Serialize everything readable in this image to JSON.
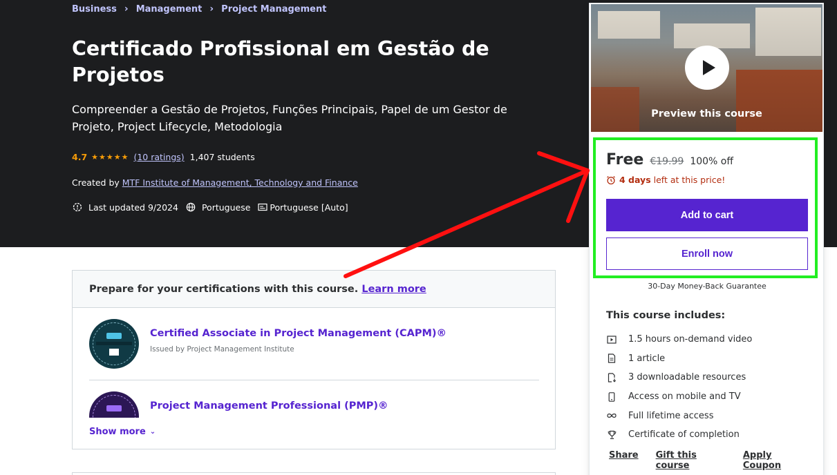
{
  "breadcrumb": {
    "items": [
      "Business",
      "Management",
      "Project Management"
    ],
    "separator": "›"
  },
  "course": {
    "title": "Certificado Profissional em Gestão de Projetos",
    "subtitle": "Compreender a Gestão de Projetos, Funções Principais, Papel de um Gestor de Projeto, Project Lifecycle, Metodologia",
    "rating": "4.7",
    "ratings_count": "(10 ratings)",
    "students": "1,407 students",
    "created_by_label": "Created by",
    "author": "MTF Institute of Management, Technology and Finance",
    "last_updated": "Last updated 9/2024",
    "language": "Portuguese",
    "captions": "Portuguese [Auto]"
  },
  "certifications": {
    "heading": "Prepare for your certifications with this course.",
    "learn_more": "Learn more",
    "items": [
      {
        "title": "Certified Associate in Project Management (CAPM)®",
        "issuer": "Issued by Project Management Institute"
      },
      {
        "title": "Project Management Professional (PMP)®",
        "issuer": ""
      }
    ],
    "show_more": "Show more"
  },
  "sidebar": {
    "preview_label": "Preview this course",
    "price": "Free",
    "original_price": "€19.99",
    "discount": "100% off",
    "timer_bold": "4 days",
    "timer_rest": "left at this price!",
    "add_to_cart": "Add to cart",
    "enroll_now": "Enroll now",
    "guarantee": "30-Day Money-Back Guarantee",
    "includes_title": "This course includes:",
    "includes": [
      {
        "icon": "video-icon",
        "label": "1.5 hours on-demand video"
      },
      {
        "icon": "article-icon",
        "label": "1 article"
      },
      {
        "icon": "download-icon",
        "label": "3 downloadable resources"
      },
      {
        "icon": "mobile-icon",
        "label": "Access on mobile and TV"
      },
      {
        "icon": "infinity-icon",
        "label": "Full lifetime access"
      },
      {
        "icon": "trophy-icon",
        "label": "Certificate of completion"
      }
    ],
    "actions": [
      "Share",
      "Gift this course",
      "Apply Coupon"
    ]
  },
  "colors": {
    "hero_bg": "#1c1d1f",
    "brand_purple": "#5624d0",
    "link_lavender": "#c0c4fc",
    "star_orange": "#f69c08",
    "timer_red": "#b32d0f",
    "annotation_green": "#22ee22",
    "annotation_red": "#ff0000"
  }
}
